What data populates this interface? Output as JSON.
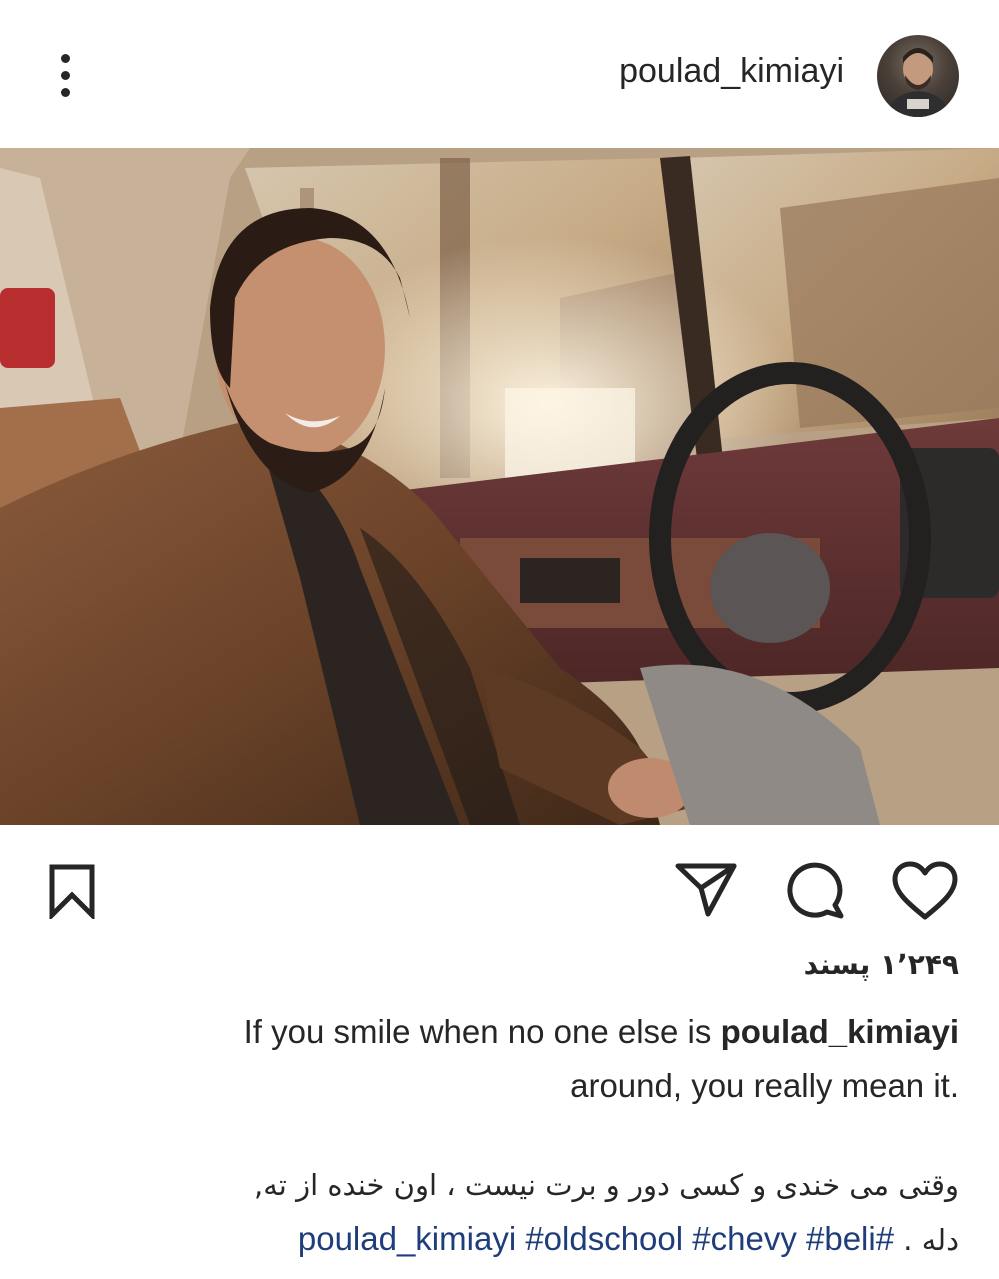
{
  "header": {
    "username": "poulad_kimiayi",
    "more_icon": "more-vertical-icon",
    "avatar_icon": "avatar"
  },
  "post": {
    "image_icon": "post-photo"
  },
  "actions": {
    "like_icon": "heart-icon",
    "comment_icon": "comment-icon",
    "share_icon": "send-icon",
    "save_icon": "bookmark-icon"
  },
  "likes": {
    "count_text": "۱٬۲۴۹ پسند"
  },
  "caption": {
    "username": "poulad_kimiayi",
    "text_en_line1": "If you smile when no one else is",
    "text_en_line2": "around, you really mean it.",
    "text_fa": "وقتی می خندی و کسی دور و برت نیست ، اون خنده از ته,",
    "tags_text": "poulad_kimiayi #oldschool #chevy #beli#",
    "tags_end": ". دله"
  },
  "colors": {
    "text": "#262626",
    "link": "#1f3d7a",
    "background": "#ffffff"
  }
}
